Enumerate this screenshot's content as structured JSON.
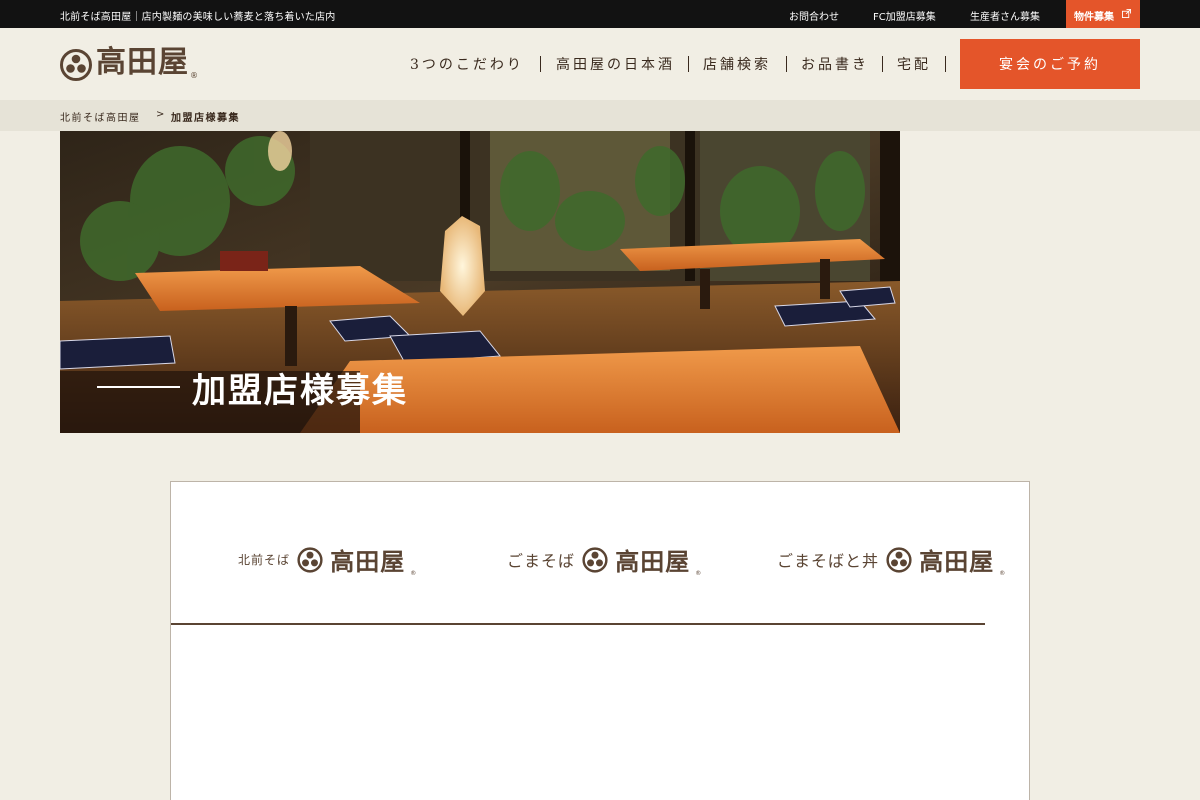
{
  "topbar": {
    "tagline": "北前そば高田屋｜店内製麺の美味しい蕎麦と落ち着いた店内",
    "links": {
      "contact": "お問合わせ",
      "fc": "FC加盟店募集",
      "producer": "生産者さん募集",
      "property": "物件募集"
    }
  },
  "header": {
    "logo_text": "高田屋",
    "logo_mark": "®",
    "nav": [
      "3つのこだわり",
      "高田屋の日本酒",
      "店舗検索",
      "お品書き",
      "宅配"
    ],
    "reserve_label": "宴会のご予約"
  },
  "breadcrumb": {
    "home": "北前そば高田屋",
    "separator": ">",
    "current": "加盟店様募集"
  },
  "hero": {
    "title": "加盟店様募集"
  },
  "brands": [
    {
      "prefix": "北前そば",
      "name": "高田屋",
      "mark": "®"
    },
    {
      "prefix": "ごまそば",
      "name": "高田屋",
      "mark": "®"
    },
    {
      "prefix": "ごまそばと丼",
      "name": "高田屋",
      "mark": "®"
    }
  ],
  "colors": {
    "accent": "#e4552a",
    "topbar_bg": "#121212",
    "page_bg": "#f1eee4",
    "brand_brown": "#5a4433"
  },
  "icons": {
    "external_link": "external-link-icon",
    "logo_mark": "three-circles-crest-icon"
  }
}
